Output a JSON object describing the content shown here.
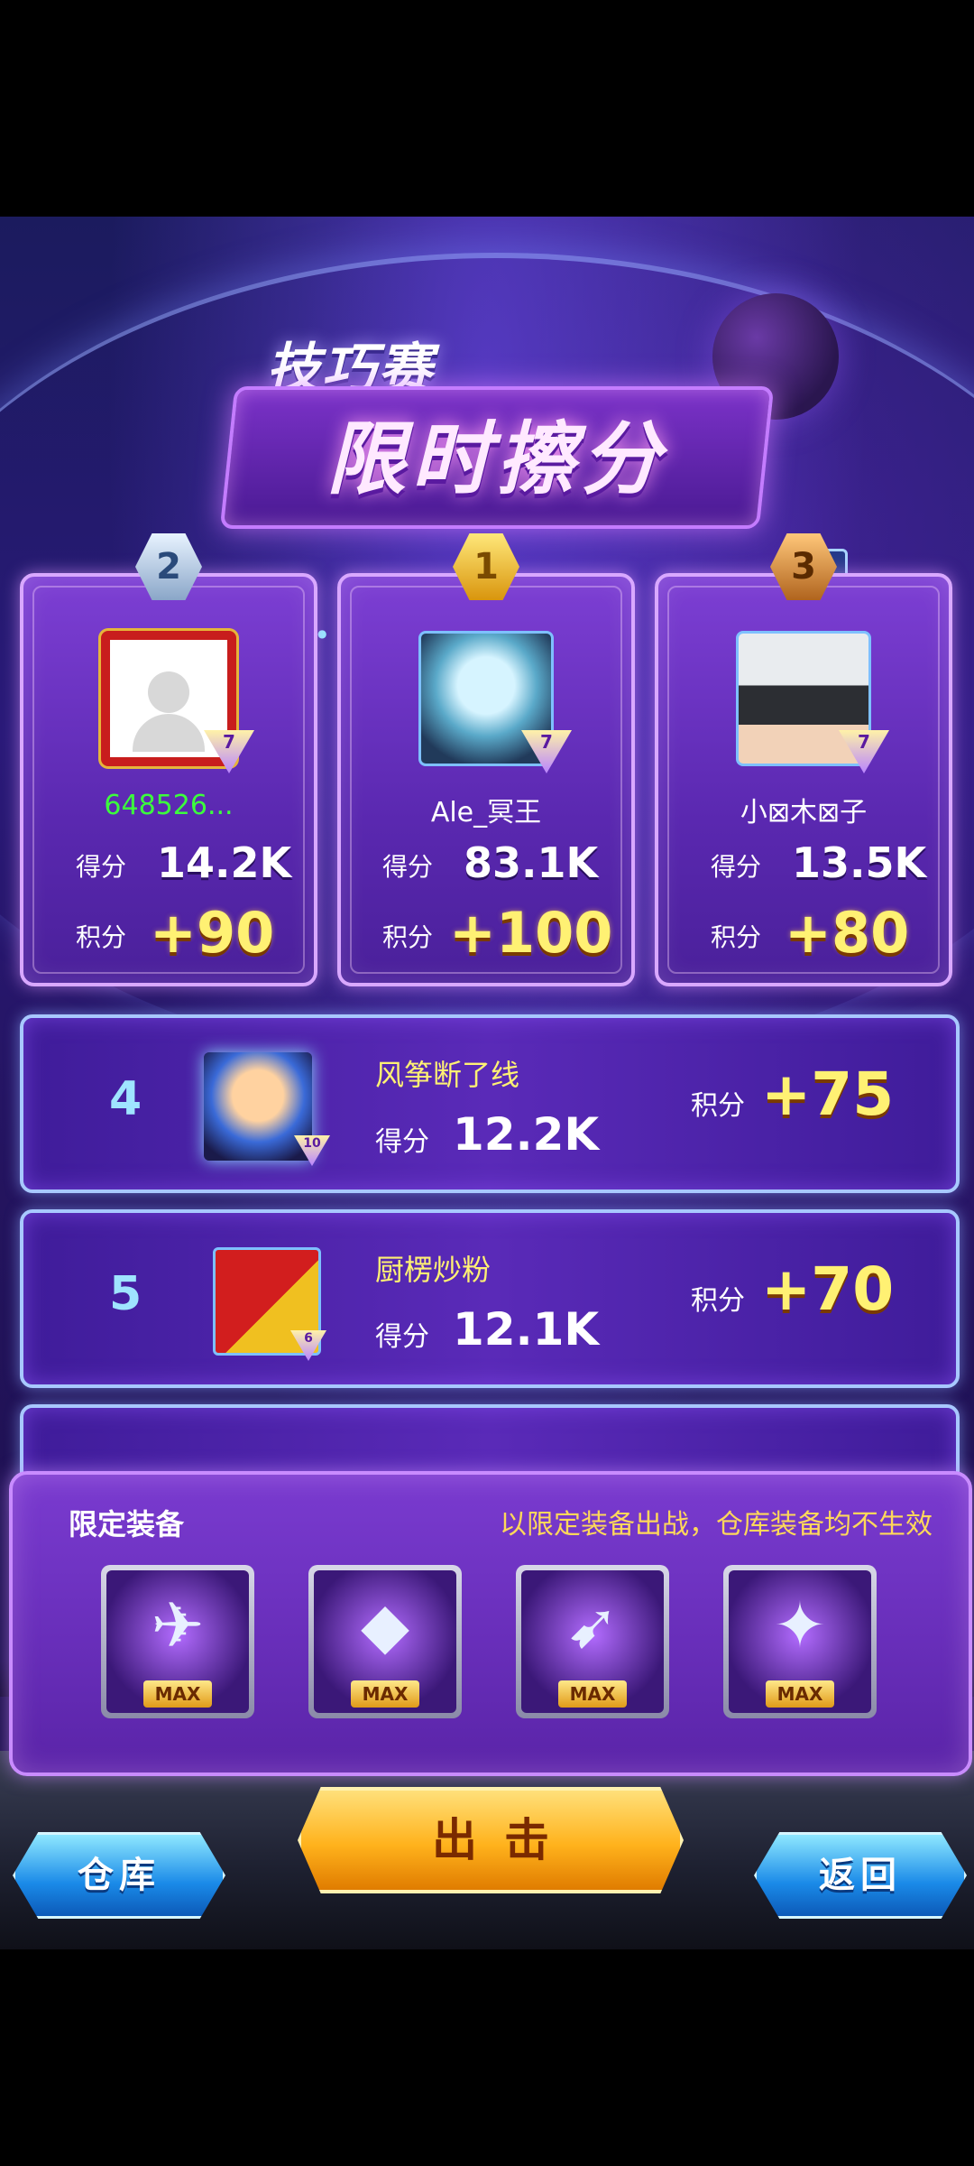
{
  "title": {
    "small": "技巧赛",
    "big": "限时擦分",
    "help_icon": "?"
  },
  "podium": [
    {
      "rank": "2",
      "medal": "silver",
      "name": "648526...",
      "name_color": "#3cff3c",
      "level": "7",
      "score_label": "得分",
      "score": "14.2K",
      "points_label": "积分",
      "points": "+90"
    },
    {
      "rank": "1",
      "medal": "gold",
      "name": "Ale_冥王",
      "name_color": "#ffffff",
      "level": "7",
      "score_label": "得分",
      "score": "83.1K",
      "points_label": "积分",
      "points": "+100"
    },
    {
      "rank": "3",
      "medal": "bronze",
      "name": "小⊠木⊠子",
      "name_color": "#ffffff",
      "level": "7",
      "score_label": "得分",
      "score": "13.5K",
      "points_label": "积分",
      "points": "+80"
    }
  ],
  "ranks": [
    {
      "rank": "4",
      "name": "风筝断了线",
      "level": "10",
      "score_label": "得分",
      "score": "12.2K",
      "points_label": "积分",
      "points": "+75"
    },
    {
      "rank": "5",
      "name": "厨楞炒粉",
      "level": "6",
      "score_label": "得分",
      "score": "12.1K",
      "points_label": "积分",
      "points": "+70"
    }
  ],
  "equipment": {
    "title": "限定装备",
    "note": "以限定装备出战，仓库装备均不生效",
    "slots": [
      {
        "icon": "fighter-jet-icon",
        "tag": "MAX"
      },
      {
        "icon": "wing-armor-icon",
        "tag": "MAX"
      },
      {
        "icon": "missile-pod-icon",
        "tag": "MAX"
      },
      {
        "icon": "drone-craft-icon",
        "tag": "MAX"
      }
    ]
  },
  "buttons": {
    "warehouse": "仓库",
    "attack": "出击",
    "back": "返回"
  },
  "colors": {
    "gold_text": "#fff173",
    "accent_cyan": "#9fe4ff",
    "name_green": "#3cff3c"
  }
}
